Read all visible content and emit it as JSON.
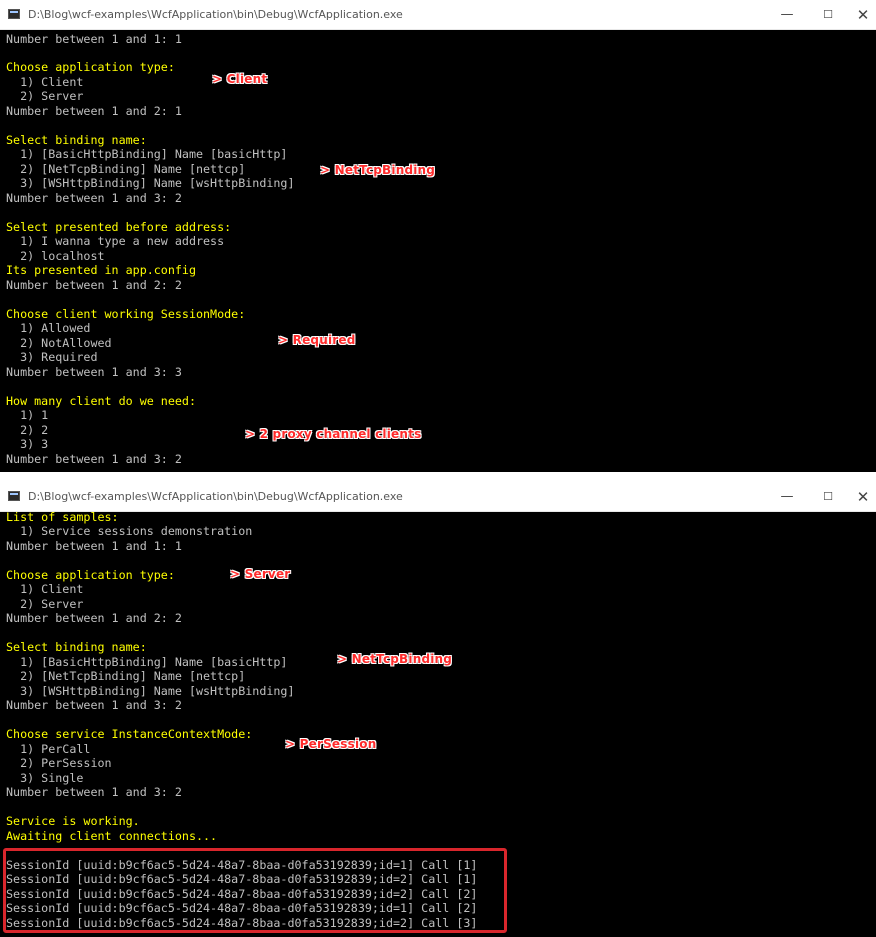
{
  "window1": {
    "title": "D:\\Blog\\wcf-examples\\WcfApplication\\bin\\Debug\\WcfApplication.exe",
    "controls": {
      "minimize": "—",
      "maximize": "☐",
      "close": "✕"
    },
    "lines": [
      {
        "text": "Number between 1 and 1: 1",
        "color": "gray"
      },
      {
        "text": "",
        "color": "gray"
      },
      {
        "text": "Choose application type:",
        "color": "yellow"
      },
      {
        "text": "  1) Client",
        "color": "gray"
      },
      {
        "text": "  2) Server",
        "color": "gray"
      },
      {
        "text": "Number between 1 and 2: 1",
        "color": "gray"
      },
      {
        "text": "",
        "color": "gray"
      },
      {
        "text": "Select binding name:",
        "color": "yellow"
      },
      {
        "text": "  1) [BasicHttpBinding] Name [basicHttp]",
        "color": "gray"
      },
      {
        "text": "  2) [NetTcpBinding] Name [nettcp]",
        "color": "gray"
      },
      {
        "text": "  3) [WSHttpBinding] Name [wsHttpBinding]",
        "color": "gray"
      },
      {
        "text": "Number between 1 and 3: 2",
        "color": "gray"
      },
      {
        "text": "",
        "color": "gray"
      },
      {
        "text": "Select presented before address:",
        "color": "yellow"
      },
      {
        "text": "  1) I wanna type a new address",
        "color": "gray"
      },
      {
        "text": "  2) localhost",
        "color": "gray"
      },
      {
        "text": "Its presented in app.config",
        "color": "yellow"
      },
      {
        "text": "Number between 1 and 2: 2",
        "color": "gray"
      },
      {
        "text": "",
        "color": "gray"
      },
      {
        "text": "Choose client working SessionMode:",
        "color": "yellow"
      },
      {
        "text": "  1) Allowed",
        "color": "gray"
      },
      {
        "text": "  2) NotAllowed",
        "color": "gray"
      },
      {
        "text": "  3) Required",
        "color": "gray"
      },
      {
        "text": "Number between 1 and 3: 3",
        "color": "gray"
      },
      {
        "text": "",
        "color": "gray"
      },
      {
        "text": "How many client do we need:",
        "color": "yellow"
      },
      {
        "text": "  1) 1",
        "color": "gray"
      },
      {
        "text": "  2) 2",
        "color": "gray"
      },
      {
        "text": "  3) 3",
        "color": "gray"
      },
      {
        "text": "Number between 1 and 3: 2",
        "color": "gray"
      }
    ],
    "annotations": [
      "> Client",
      "> NetTcpBinding",
      "> Required",
      "> 2 proxy channel clients"
    ]
  },
  "window2": {
    "title": "D:\\Blog\\wcf-examples\\WcfApplication\\bin\\Debug\\WcfApplication.exe",
    "controls": {
      "minimize": "—",
      "maximize": "☐",
      "close": "✕"
    },
    "lines": [
      {
        "text": "List of samples:",
        "color": "yellow"
      },
      {
        "text": "  1) Service sessions demonstration",
        "color": "gray"
      },
      {
        "text": "Number between 1 and 1: 1",
        "color": "gray"
      },
      {
        "text": "",
        "color": "gray"
      },
      {
        "text": "Choose application type:",
        "color": "yellow"
      },
      {
        "text": "  1) Client",
        "color": "gray"
      },
      {
        "text": "  2) Server",
        "color": "gray"
      },
      {
        "text": "Number between 1 and 2: 2",
        "color": "gray"
      },
      {
        "text": "",
        "color": "gray"
      },
      {
        "text": "Select binding name:",
        "color": "yellow"
      },
      {
        "text": "  1) [BasicHttpBinding] Name [basicHttp]",
        "color": "gray"
      },
      {
        "text": "  2) [NetTcpBinding] Name [nettcp]",
        "color": "gray"
      },
      {
        "text": "  3) [WSHttpBinding] Name [wsHttpBinding]",
        "color": "gray"
      },
      {
        "text": "Number between 1 and 3: 2",
        "color": "gray"
      },
      {
        "text": "",
        "color": "gray"
      },
      {
        "text": "Choose service InstanceContextMode:",
        "color": "yellow"
      },
      {
        "text": "  1) PerCall",
        "color": "gray"
      },
      {
        "text": "  2) PerSession",
        "color": "gray"
      },
      {
        "text": "  3) Single",
        "color": "gray"
      },
      {
        "text": "Number between 1 and 3: 2",
        "color": "gray"
      },
      {
        "text": "",
        "color": "gray"
      },
      {
        "text": "Service is working.",
        "color": "yellow"
      },
      {
        "text": "Awaiting client connections...",
        "color": "yellow"
      },
      {
        "text": "",
        "color": "gray"
      },
      {
        "text": "SessionId [uuid:b9cf6ac5-5d24-48a7-8baa-d0fa53192839;id=1] Call [1]",
        "color": "gray"
      },
      {
        "text": "SessionId [uuid:b9cf6ac5-5d24-48a7-8baa-d0fa53192839;id=2] Call [1]",
        "color": "gray"
      },
      {
        "text": "SessionId [uuid:b9cf6ac5-5d24-48a7-8baa-d0fa53192839;id=2] Call [2]",
        "color": "gray"
      },
      {
        "text": "SessionId [uuid:b9cf6ac5-5d24-48a7-8baa-d0fa53192839;id=1] Call [2]",
        "color": "gray"
      },
      {
        "text": "SessionId [uuid:b9cf6ac5-5d24-48a7-8baa-d0fa53192839;id=2] Call [3]",
        "color": "gray"
      }
    ],
    "annotations": [
      "> Server",
      "> NetTcpBinding",
      "> PerSession"
    ]
  },
  "colors": {
    "console_bg": "#000000",
    "text_gray": "#c0c0c0",
    "text_yellow": "#ffff00",
    "annotation_red": "#ff2b2b",
    "highlight_border": "#d9262c"
  }
}
